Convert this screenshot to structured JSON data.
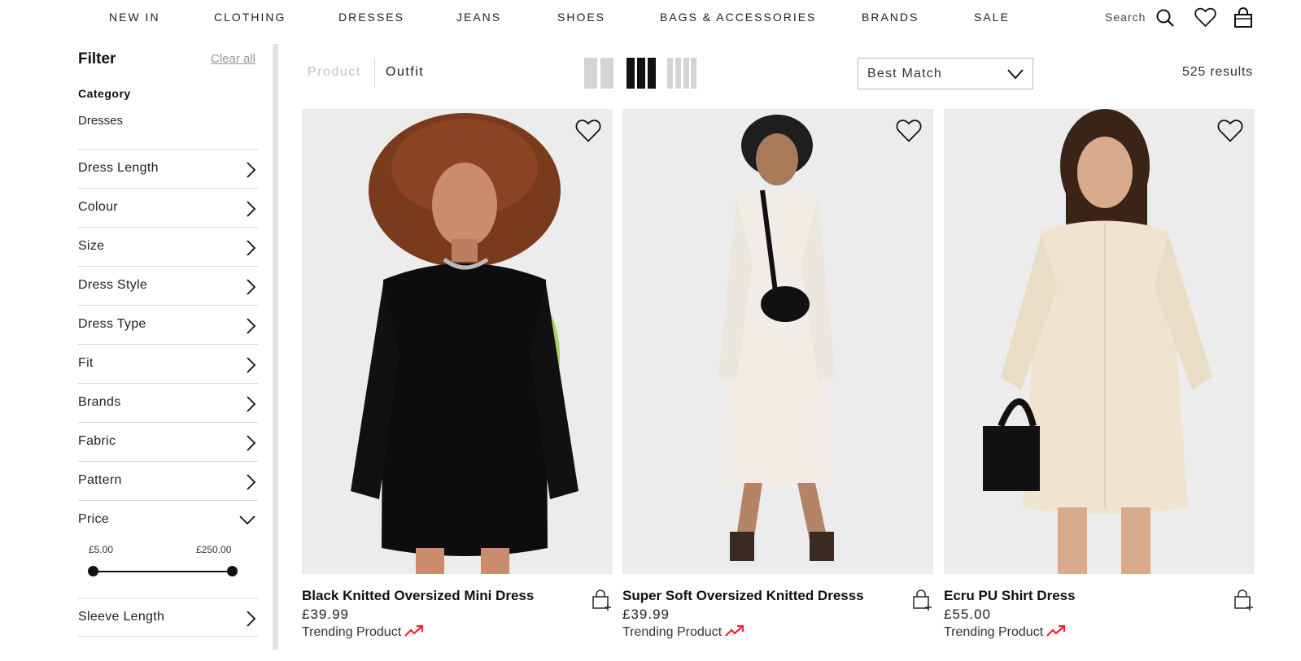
{
  "nav": {
    "items": [
      "NEW IN",
      "CLOTHING",
      "DRESSES",
      "JEANS",
      "SHOES",
      "BAGS & ACCESSORIES",
      "BRANDS",
      "SALE"
    ],
    "search_label": "Search"
  },
  "filter": {
    "title": "Filter",
    "clear_all": "Clear all",
    "category_heading": "Category",
    "category_value": "Dresses",
    "facets": [
      "Dress Length",
      "Colour",
      "Size",
      "Dress Style",
      "Dress Type",
      "Fit",
      "Brands",
      "Fabric",
      "Pattern"
    ],
    "price": {
      "label": "Price",
      "min_label": "£5.00",
      "max_label": "£250.00",
      "min_value": 5,
      "max_value": 250
    },
    "after_price": [
      "Sleeve Length"
    ]
  },
  "toolbar": {
    "tab_product": "Product",
    "tab_outfit": "Outfit",
    "active_tab": "Outfit",
    "grid_options": [
      "2-column",
      "3-column",
      "4-column"
    ],
    "active_grid": "3-column",
    "sort_value": "Best Match",
    "results": "525 results"
  },
  "products": [
    {
      "name": "Black Knitted Oversized Mini Dress",
      "price": "£39.99",
      "tag": "Trending Product",
      "image": "model-black-knit-dress"
    },
    {
      "name": "Super Soft Oversized Knitted Dresss",
      "price": "£39.99",
      "tag": "Trending Product",
      "image": "model-cream-knit-dress"
    },
    {
      "name": "Ecru PU Shirt Dress",
      "price": "£55.00",
      "tag": "Trending Product",
      "image": "model-ecru-shirt-dress"
    }
  ],
  "colors": {
    "accent_trend": "#e8233a",
    "photo_bg": "#ececec",
    "border": "#d6d6d6"
  }
}
